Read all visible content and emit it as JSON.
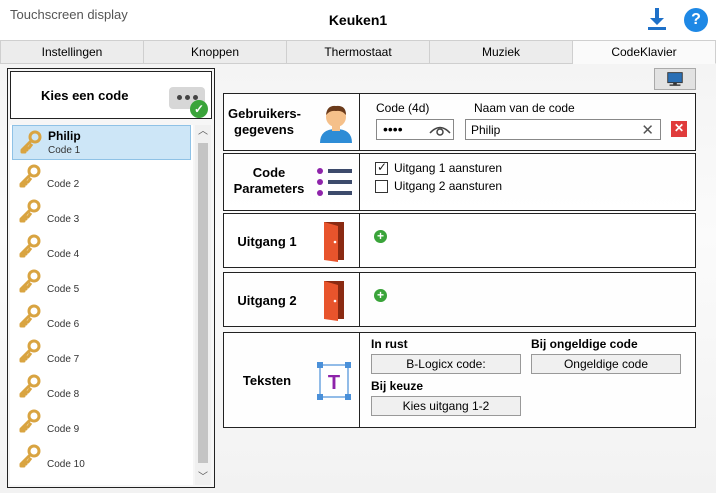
{
  "app": {
    "title": "Touchscreen display",
    "window_title": "Keuken1"
  },
  "tabs": [
    {
      "label": "Instellingen"
    },
    {
      "label": "Knoppen"
    },
    {
      "label": "Thermostaat"
    },
    {
      "label": "Muziek"
    },
    {
      "label": "CodeKlavier",
      "active": true
    }
  ],
  "left": {
    "picker_label": "Kies een code",
    "codes": [
      {
        "name": "Philip",
        "sub": "Code 1",
        "selected": true
      },
      {
        "name": "",
        "sub": "Code 2"
      },
      {
        "name": "",
        "sub": "Code 3"
      },
      {
        "name": "",
        "sub": "Code 4"
      },
      {
        "name": "",
        "sub": "Code 5"
      },
      {
        "name": "",
        "sub": "Code 6"
      },
      {
        "name": "",
        "sub": "Code 7"
      },
      {
        "name": "",
        "sub": "Code 8"
      },
      {
        "name": "",
        "sub": "Code 9"
      },
      {
        "name": "",
        "sub": "Code 10"
      }
    ]
  },
  "user": {
    "title": "Gebruikers-\ngegevens",
    "code_label": "Code (4d)",
    "code_value": "••••",
    "name_label": "Naam van de code",
    "name_value": "Philip"
  },
  "params": {
    "title": "Code\nParameters",
    "options": [
      {
        "label": "Uitgang 1 aansturen",
        "checked": true
      },
      {
        "label": "Uitgang 2 aansturen",
        "checked": false
      }
    ]
  },
  "outputs": [
    {
      "title": "Uitgang 1"
    },
    {
      "title": "Uitgang 2"
    }
  ],
  "texts": {
    "title": "Teksten",
    "idle_label": "In rust",
    "idle_value": "B-Logicx code:",
    "invalid_label": "Bij ongeldige code",
    "invalid_value": "Ongeldige code",
    "choice_label": "Bij keuze",
    "choice_value": "Kies uitgang 1-2"
  },
  "colors": {
    "accent": "#1e88e5",
    "delete": "#e03b3b",
    "add": "#3aa43a",
    "door": "#e8542c",
    "text_icon": "#8e24aa"
  }
}
